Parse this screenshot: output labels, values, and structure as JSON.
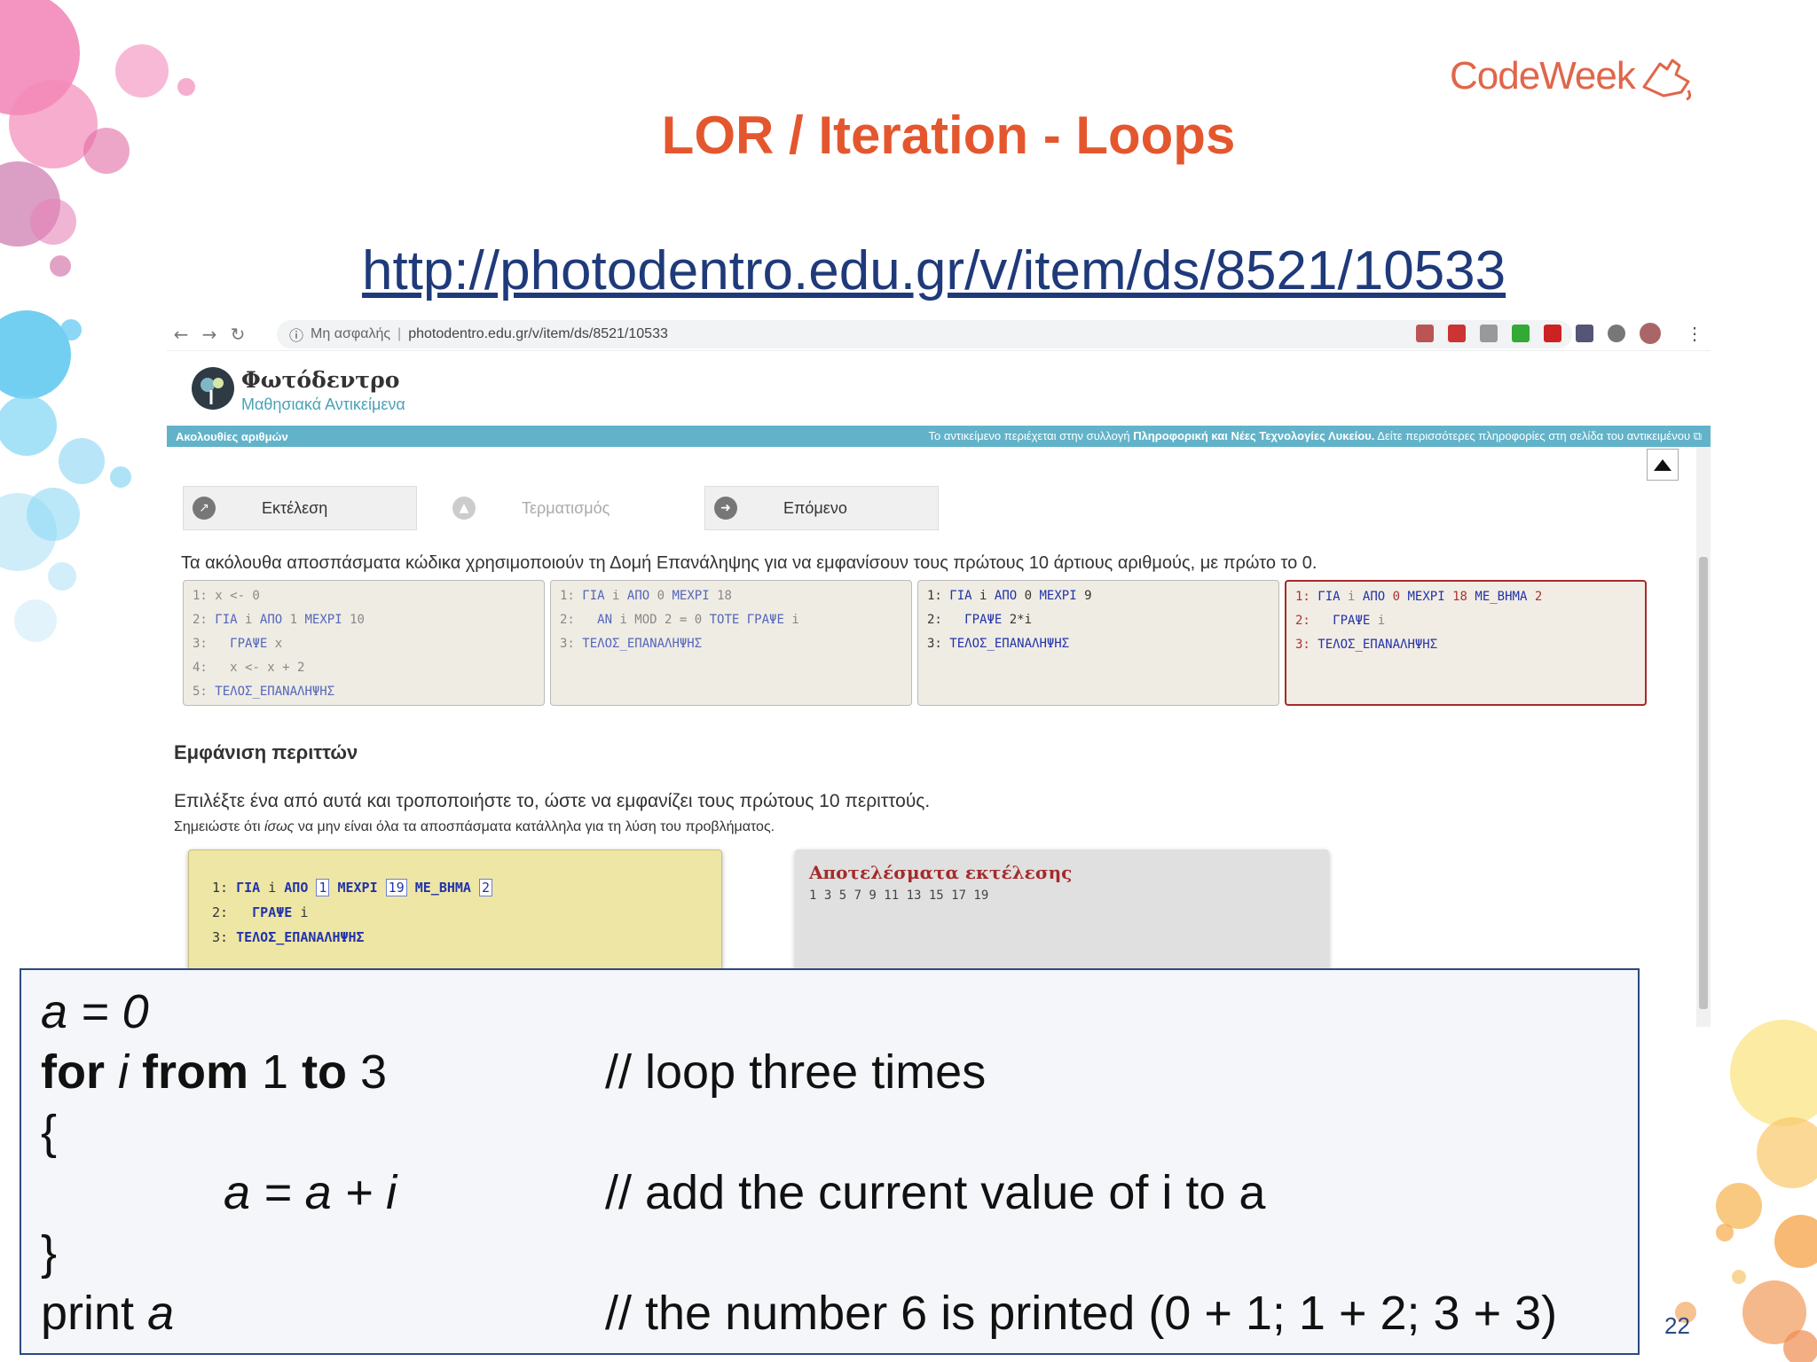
{
  "logo": {
    "text": "CodeWeek",
    "icon": "pointer-hand-icon"
  },
  "slide": {
    "title": "LOR / Iteration - Loops",
    "url": "http://photodentro.edu.gr/v/item/ds/8521/10533",
    "page_number": "22"
  },
  "browser": {
    "insecure_label": "Μη ασφαλής",
    "address": "photodentro.edu.gr/v/item/ds/8521/10533"
  },
  "site": {
    "name": "Φωτόδεντρο",
    "subtitle": "Μαθησιακά Αντικείμενα",
    "bar_left": "Ακολουθίες αριθμών",
    "bar_right_prefix": "Το αντικείμενο περιέχεται στην συλλογή ",
    "bar_right_bold": "Πληροφορική και Νέες Τεχνολογίες Λυκείου.",
    "bar_right_suffix": " Δείτε περισσότερες πληροφορίες στη σελίδα του αντικειμένου"
  },
  "app": {
    "run_label": "Εκτέλεση",
    "stop_label": "Τερματισμός",
    "next_label": "Επόμενο",
    "intro": "Τα ακόλουθα αποσπάσματα κώδικα χρησιμοποιούν τη Δομή Επανάληψης για να εμφανίσουν τους πρώτους 10 άρτιους αριθμούς, με πρώτο το 0.",
    "section_title": "Εμφάνιση περιττών",
    "instruction": "Επιλέξτε ένα από αυτά και τροποποιήστε το, ώστε να εμφανίζει τους πρώτους 10 περιττούς.",
    "note_prefix": "Σημειώστε ότι ",
    "note_em": "ίσως",
    "note_suffix": " να μην είναι όλα τα αποσπάσματα κατάλληλα για τη λύση του προβλήματος.",
    "results_title": "Αποτελέσματα εκτέλεσης",
    "results_value": "1 3 5 7 9 11 13 15 17 19"
  },
  "editor": {
    "line1_num": "1:",
    "kw_for": "ΓΙΑ",
    "var": "i",
    "kw_from": "ΑΠΟ",
    "from_val": "1",
    "kw_to": "ΜΕΧΡΙ",
    "to_val": "19",
    "kw_step": "ΜΕ_ΒΗΜΑ",
    "step_val": "2",
    "line2_num": "2:",
    "kw_print": "ΓΡΑΨΕ",
    "line3_num": "3:",
    "kw_end": "ΤΕΛΟΣ_ΕΠΑΝΑΛΗΨΗΣ"
  },
  "pseudocode": {
    "l1": "a = 0",
    "l2_for": "for",
    "l2_i": "i",
    "l2_from": "from",
    "l2_one": " 1 ",
    "l2_to": "to",
    "l2_three": " 3",
    "l2_comment": "// loop three times",
    "l3": "{",
    "l4": "a = a + i",
    "l4_comment": "// add the current value of i to a",
    "l5": "}",
    "l6_print": "print ",
    "l6_a": "a",
    "l6_comment": "// the number 6 is printed (0 + 1; 1 + 2; 3 + 3)"
  },
  "colors": {
    "title": "#e4572e",
    "url": "#1f3a7a",
    "box_border": "#2c4a7e",
    "bar": "#62b3c9"
  }
}
